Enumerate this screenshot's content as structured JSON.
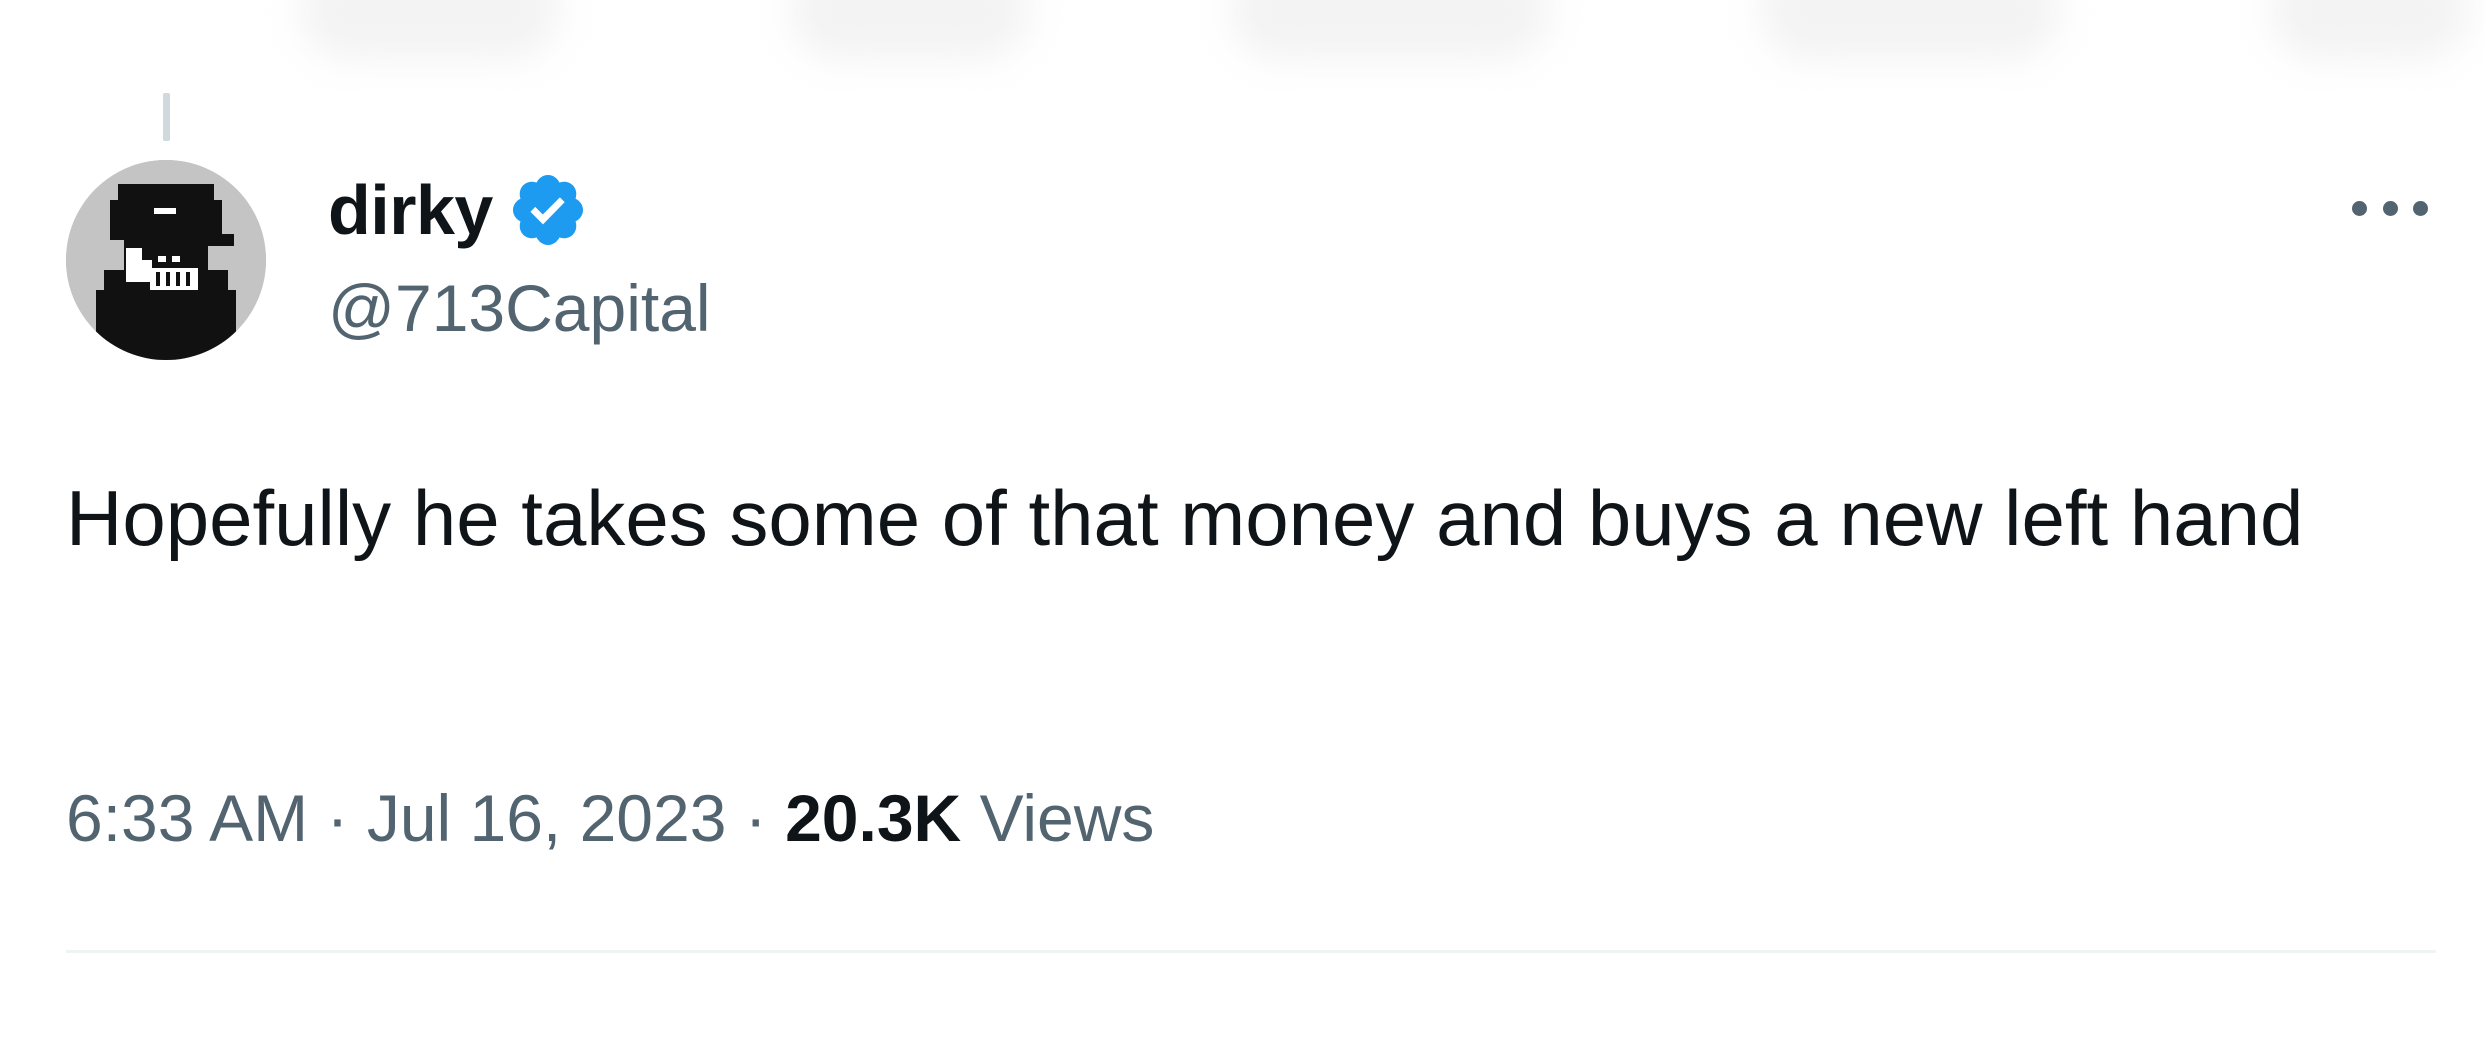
{
  "tweet": {
    "author": {
      "display_name": "dirky",
      "handle": "@713Capital",
      "verified": true,
      "verified_color": "#1d9bf0",
      "avatar_icon": "pixel-avatar-icon"
    },
    "text": "Hopefully he takes some of that money and buys a new left hand",
    "time": "6:33 AM",
    "separator": " · ",
    "date": "Jul 16, 2023",
    "views_count": "20.3K",
    "views_label": "Views",
    "more_icon": "more-horizontal-icon"
  },
  "colors": {
    "primary_text": "#0f1419",
    "secondary_text": "#536471",
    "divider": "#eff3f4"
  }
}
